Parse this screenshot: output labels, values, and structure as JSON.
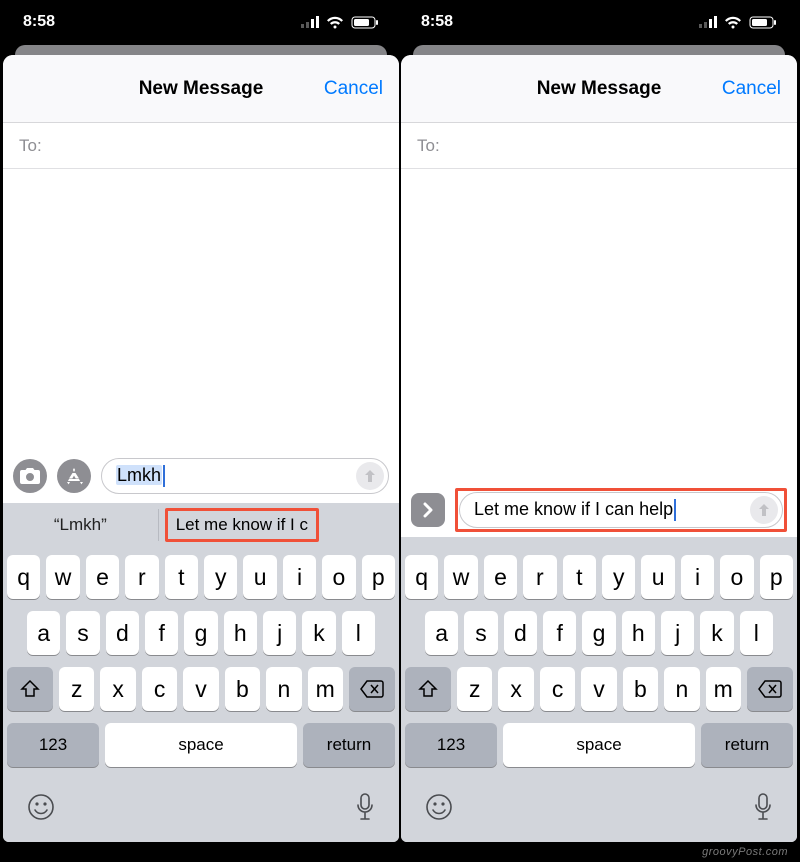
{
  "status": {
    "time": "8:58"
  },
  "nav": {
    "title": "New Message",
    "cancel": "Cancel"
  },
  "to": {
    "label": "To:"
  },
  "left": {
    "message_text": "Lmkh",
    "prediction_literal": "“Lmkh”",
    "prediction_expand": "Let me know if I c"
  },
  "right": {
    "message_text": "Let me know if I can help"
  },
  "keyboard": {
    "row1": [
      "q",
      "w",
      "e",
      "r",
      "t",
      "y",
      "u",
      "i",
      "o",
      "p"
    ],
    "row2": [
      "a",
      "s",
      "d",
      "f",
      "g",
      "h",
      "j",
      "k",
      "l"
    ],
    "row3": [
      "z",
      "x",
      "c",
      "v",
      "b",
      "n",
      "m"
    ],
    "num": "123",
    "space": "space",
    "return": "return"
  },
  "watermark": "groovyPost.com"
}
